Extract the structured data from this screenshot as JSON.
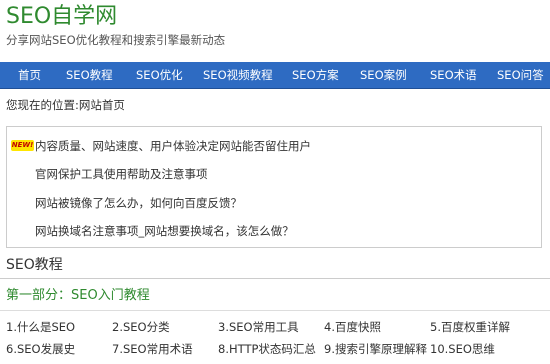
{
  "site": {
    "title": "SEO自学网",
    "subtitle": "分享网站SEO优化教程和搜索引擎最新动态"
  },
  "nav": {
    "items": [
      "首页",
      "SEO教程",
      "SEO优化",
      "SEO视频教程",
      "SEO方案",
      "SEO案例",
      "SEO术语",
      "SEO问答"
    ]
  },
  "breadcrumb": {
    "prefix": "您现在的位置:",
    "current": "网站首页"
  },
  "news": {
    "badge": "NEW!",
    "items": [
      "内容质量、网站速度、用户体验决定网站能否留住用户",
      "官网保护工具使用帮助及注意事项",
      "网站被镜像了怎么办，如何向百度反馈？",
      "网站换域名注意事项_网站想要换域名，该怎么做？"
    ]
  },
  "tutorial": {
    "title": "SEO教程",
    "part_title": "第一部分：SEO入门教程",
    "lessons": [
      "1.什么是SEO",
      "2.SEO分类",
      "3.SEO常用工具",
      "4.百度快照",
      "5.百度权重详解",
      "6.SEO发展史",
      "7.SEO常用术语",
      "8.HTTP状态码汇总",
      "9.搜索引擎原理解释",
      "10.SEO思维"
    ]
  },
  "colors": {
    "brand_green": "#2f8a2f",
    "nav_blue": "#2e6bc2"
  }
}
